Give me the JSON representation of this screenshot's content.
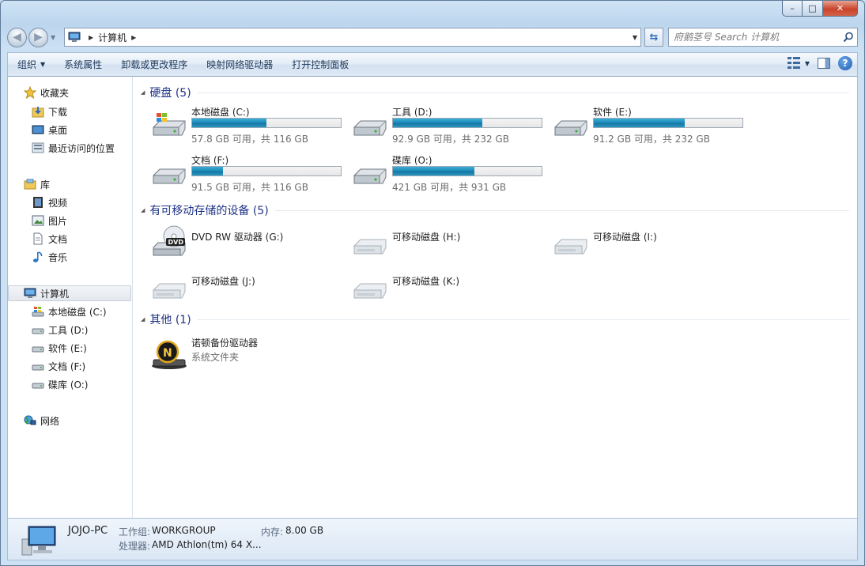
{
  "window": {
    "title_buttons": {
      "minimize": "–",
      "maximize": "□",
      "close": "✕"
    }
  },
  "nav": {
    "back_icon": "back-arrow-icon",
    "forward_icon": "forward-arrow-icon",
    "breadcrumb": [
      "计算机"
    ],
    "search_placeholder": "府鹅茎号 Search 计算机"
  },
  "toolbar": {
    "organize": "组织",
    "system_properties": "系统属性",
    "uninstall": "卸载或更改程序",
    "map_drive": "映射网络驱动器",
    "control_panel": "打开控制面板"
  },
  "sidebar": {
    "favorites": {
      "label": "收藏夹",
      "items": [
        "下载",
        "桌面",
        "最近访问的位置"
      ]
    },
    "libraries": {
      "label": "库",
      "items": [
        "视频",
        "图片",
        "文档",
        "音乐"
      ]
    },
    "computer": {
      "label": "计算机",
      "items": [
        "本地磁盘 (C:)",
        "工具 (D:)",
        "软件 (E:)",
        "文档 (F:)",
        "碟库 (O:)"
      ]
    },
    "network": {
      "label": "网络"
    }
  },
  "sections": {
    "hdd": "硬盘 (5)",
    "removable": "有可移动存储的设备 (5)",
    "other": "其他 (1)"
  },
  "drives": [
    {
      "name": "本地磁盘 (C:)",
      "free": "57.8 GB 可用，共 116 GB",
      "used_fraction": 0.5,
      "icon": "windows-drive-icon"
    },
    {
      "name": "工具 (D:)",
      "free": "92.9 GB 可用，共 232 GB",
      "used_fraction": 0.6,
      "icon": "hard-drive-icon"
    },
    {
      "name": "软件 (E:)",
      "free": "91.2 GB 可用，共 232 GB",
      "used_fraction": 0.61,
      "icon": "hard-drive-icon"
    },
    {
      "name": "文档 (F:)",
      "free": "91.5 GB 可用，共 116 GB",
      "used_fraction": 0.21,
      "icon": "hard-drive-icon"
    },
    {
      "name": "碟库 (O:)",
      "free": "421 GB 可用，共 931 GB",
      "used_fraction": 0.55,
      "icon": "hard-drive-icon"
    }
  ],
  "removable": [
    {
      "name": "DVD RW 驱动器 (G:)",
      "icon": "dvd-drive-icon"
    },
    {
      "name": "可移动磁盘 (H:)",
      "icon": "removable-disk-icon"
    },
    {
      "name": "可移动磁盘 (I:)",
      "icon": "removable-disk-icon"
    },
    {
      "name": "可移动磁盘 (J:)",
      "icon": "removable-disk-icon"
    },
    {
      "name": "可移动磁盘 (K:)",
      "icon": "removable-disk-icon"
    }
  ],
  "other": [
    {
      "name": "诺顿备份驱动器",
      "subtitle": "系统文件夹",
      "icon": "norton-backup-icon"
    }
  ],
  "details": {
    "pc_name": "JOJO-PC",
    "workgroup_label": "工作组:",
    "workgroup": "WORKGROUP",
    "memory_label": "内存:",
    "memory": "8.00 GB",
    "cpu_label": "处理器:",
    "cpu": "AMD Athlon(tm) 64 X..."
  },
  "colors": {
    "accent": "#1e3287",
    "bar_fill": "#1f8ab8",
    "window_frame": "#bcd6ee"
  }
}
